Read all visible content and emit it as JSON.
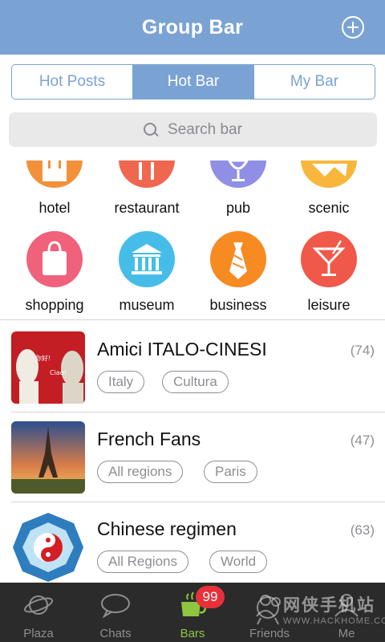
{
  "header": {
    "title": "Group Bar",
    "add_icon": "plus-circle-icon"
  },
  "tabs": [
    {
      "label": "Hot Posts",
      "active": false
    },
    {
      "label": "Hot Bar",
      "active": true
    },
    {
      "label": "My Bar",
      "active": false
    }
  ],
  "search": {
    "placeholder": "Search bar",
    "icon": "search-icon"
  },
  "categories": [
    {
      "label": "hotel",
      "color": "#f3913a",
      "icon": "hotel-icon"
    },
    {
      "label": "restaurant",
      "color": "#f0674f",
      "icon": "restaurant-icon"
    },
    {
      "label": "pub",
      "color": "#8f8fe6",
      "icon": "wine-glass-icon"
    },
    {
      "label": "scenic",
      "color": "#f8b73c",
      "icon": "scenic-icon"
    },
    {
      "label": "shopping",
      "color": "#f0617b",
      "icon": "shopping-bag-icon"
    },
    {
      "label": "museum",
      "color": "#45bde8",
      "icon": "museum-icon"
    },
    {
      "label": "business",
      "color": "#f88a22",
      "icon": "tie-icon"
    },
    {
      "label": "leisure",
      "color": "#f0584a",
      "icon": "cocktail-icon"
    }
  ],
  "groups": [
    {
      "title": "Amici ITALO-CINESI",
      "count": "(74)",
      "tags": [
        "Italy",
        "Cultura"
      ],
      "thumb_text_1": "你好!",
      "thumb_text_2": "Ciao!"
    },
    {
      "title": "French Fans",
      "count": "(47)",
      "tags": [
        "All regions",
        "Paris"
      ]
    },
    {
      "title": "Chinese regimen",
      "count": "(63)",
      "tags": [
        "All Regions",
        "World"
      ]
    }
  ],
  "tabbar": {
    "items": [
      {
        "label": "Plaza",
        "icon": "planet-icon",
        "active": false
      },
      {
        "label": "Chats",
        "icon": "chat-bubbles-icon",
        "active": false
      },
      {
        "label": "Bars",
        "icon": "coffee-cup-icon",
        "active": true,
        "badge": "99"
      },
      {
        "label": "Friends",
        "icon": "friends-icon",
        "active": false
      },
      {
        "label": "Me",
        "icon": "me-icon",
        "active": false
      }
    ]
  },
  "watermark": {
    "line1": "网侠手机站",
    "line2": "WWW.HACKHOME.COM"
  },
  "colors": {
    "accent": "#7aa3d3",
    "active_green": "#8ec63f",
    "badge_red": "#e8303a"
  }
}
